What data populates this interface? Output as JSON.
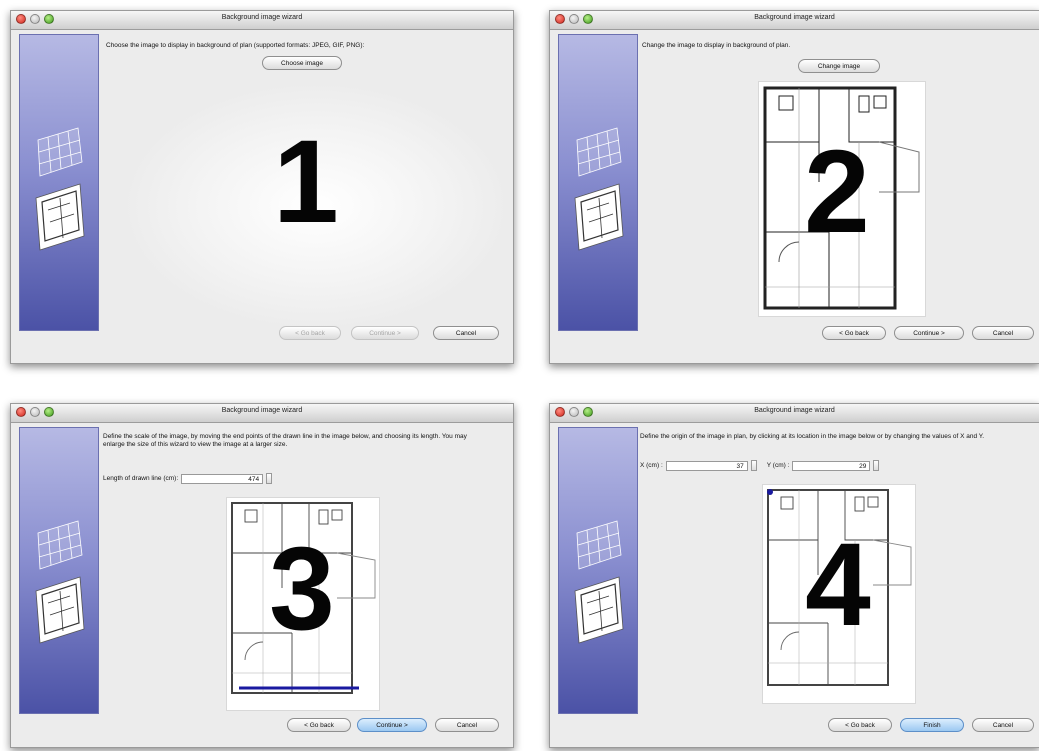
{
  "windows": [
    {
      "title": "Background image wizard",
      "step_number": "1",
      "instruction": "Choose the image to display in background of plan (supported formats: JPEG, GIF, PNG):",
      "action_button": "Choose image",
      "buttons": {
        "back": "< Go back",
        "continue": "Continue >",
        "cancel": "Cancel"
      }
    },
    {
      "title": "Background image wizard",
      "step_number": "2",
      "instruction": "Change the image to display in background of plan.",
      "action_button": "Change image",
      "buttons": {
        "back": "< Go back",
        "continue": "Continue >",
        "cancel": "Cancel"
      }
    },
    {
      "title": "Background image wizard",
      "step_number": "3",
      "instruction": "Define the scale of the image, by moving the end points of the drawn line in the image below, and choosing its length. You may enlarge the size of this wizard to view the image at a larger size.",
      "length_label": "Length of drawn line (cm):",
      "length_value": "474",
      "buttons": {
        "back": "< Go back",
        "continue": "Continue >",
        "cancel": "Cancel"
      }
    },
    {
      "title": "Background image wizard",
      "step_number": "4",
      "instruction": "Define the origin of the image in plan, by clicking at its location in the image below or by changing the values of X and Y.",
      "x_label": "X (cm) :",
      "x_value": "37",
      "y_label": "Y (cm) :",
      "y_value": "29",
      "buttons": {
        "back": "< Go back",
        "finish": "Finish",
        "cancel": "Cancel"
      }
    }
  ],
  "colors": {
    "sidebar_top": "#b6b9e4",
    "sidebar_bottom": "#4b52a6",
    "scale_line": "#1a1aa0",
    "default_button": "#9cc8f1"
  },
  "icons": [
    "window-close-icon",
    "window-minimize-icon",
    "window-zoom-icon",
    "plan-wizard-icon",
    "floor-plan-image"
  ]
}
